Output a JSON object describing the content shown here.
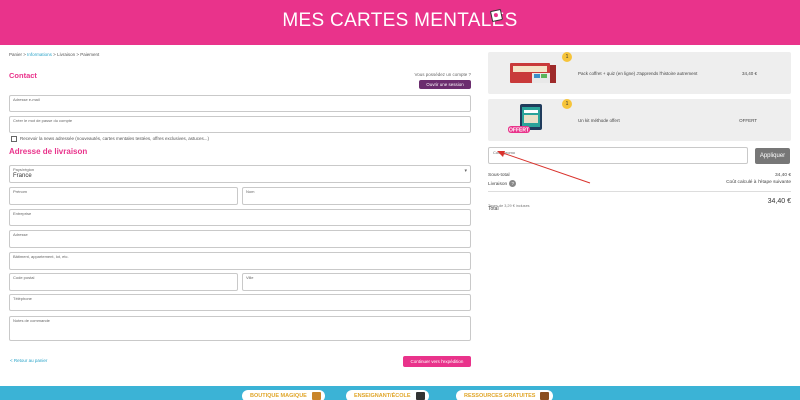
{
  "header": {
    "title": "MES CARTES MENTALES",
    "logo_icon": "card-logo-icon",
    "bg": "#e9338b"
  },
  "breadcrumb": {
    "items": [
      "Panier",
      "Informations",
      "Livraison",
      "Paiement"
    ],
    "sep": " > ",
    "active": "Informations"
  },
  "contact": {
    "heading": "Contact",
    "have_account": "Vous possédez un compte ?",
    "login_label": "Ouvrir une session",
    "email_label": "Adresse e-mail",
    "password_label": "Créer le mot de passe du compte",
    "newsletter_label": "Recevoir la news adressée (nouveautés, cartes mentales testées, offres exclusives, astuces...)"
  },
  "shipping": {
    "heading": "Adresse de livraison",
    "country_label": "Pays/région",
    "country_value": "France",
    "firstname_label": "Prénom",
    "lastname_label": "Nom",
    "company_label": "Entreprise",
    "address_label": "Adresse",
    "address2_label": "Bâtiment, appartement, lot, etc.",
    "zip_label": "Code postal",
    "city_label": "Ville",
    "phone_label": "Téléphone",
    "notes_label": "Notes de commande"
  },
  "actions": {
    "back_label": "< Retour au panier",
    "continue_label": "Continuer vers l'expédition"
  },
  "summary": {
    "items": [
      {
        "qty": "1",
        "name": "Pack coffret + quiz (en ligne) J'apprends l'histoire autrement",
        "price": "34,40 €",
        "thumb_icon": "product-box-icon"
      },
      {
        "qty": "1",
        "name": "Un kit méthode offert",
        "price": "OFFERT",
        "badge": "OFFERT",
        "thumb_icon": "method-kit-icon"
      }
    ],
    "promo_label": "Code promo",
    "apply_label": "Appliquer",
    "subtotal_label": "Sous-total",
    "subtotal_value": "34,40 €",
    "shipping_label": "Livraison",
    "shipping_value": "Coût calculé à l'étape suivante",
    "total_label": "Total",
    "total_value": "34,40 €",
    "tax_note": "Taxes de 3,29 € incluses"
  },
  "footer": {
    "bg": "#3bb3d6",
    "links": [
      {
        "label": "BOUTIQUE MAGIQUE",
        "icon": "shop-icon"
      },
      {
        "label": "ENSEIGNANT/ÉCOLE",
        "icon": "graduation-cap-icon"
      },
      {
        "label": "RESSOURCES GRATUITES",
        "icon": "treasure-chest-icon"
      }
    ]
  }
}
